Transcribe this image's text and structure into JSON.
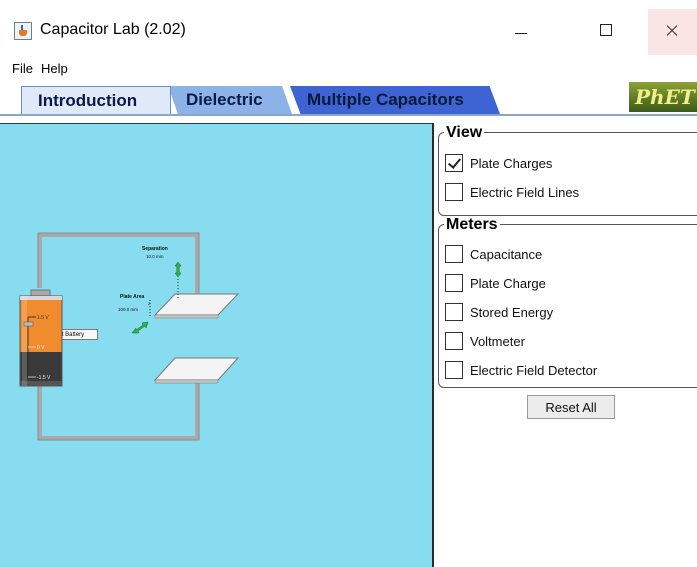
{
  "window": {
    "title": "Capacitor Lab (2.02)"
  },
  "menu": {
    "items": [
      "File",
      "Help"
    ]
  },
  "tabs": [
    {
      "label": "Introduction",
      "selected": true
    },
    {
      "label": "Dielectric",
      "selected": false
    },
    {
      "label": "Multiple Capacitors",
      "selected": false
    }
  ],
  "logo": {
    "text": "PhET"
  },
  "circuit": {
    "disconnect_label": "Disconnect Battery",
    "separation_label": "Separation",
    "separation_value": "10.0 mm",
    "plate_area_label": "Plate Area",
    "plate_area_value": "100.0 mm",
    "plate_area_exponent": "2",
    "battery_ticks": [
      "1.5 V",
      "0 V",
      "-1.5 V"
    ]
  },
  "panel": {
    "view": {
      "title": "View",
      "options": [
        {
          "label": "Plate Charges",
          "checked": true
        },
        {
          "label": "Electric Field Lines",
          "checked": false
        }
      ]
    },
    "meters": {
      "title": "Meters",
      "options": [
        {
          "label": "Capacitance",
          "checked": false
        },
        {
          "label": "Plate Charge",
          "checked": false
        },
        {
          "label": "Stored Energy",
          "checked": false
        },
        {
          "label": "Voltmeter",
          "checked": false
        },
        {
          "label": "Electric Field Detector",
          "checked": false
        }
      ]
    },
    "reset_label": "Reset All"
  },
  "colors": {
    "play_area_bg": "#87dcef",
    "battery_top": "#f08c2e",
    "battery_bottom": "#3a3a3a",
    "arrow_green": "#2db14b"
  }
}
